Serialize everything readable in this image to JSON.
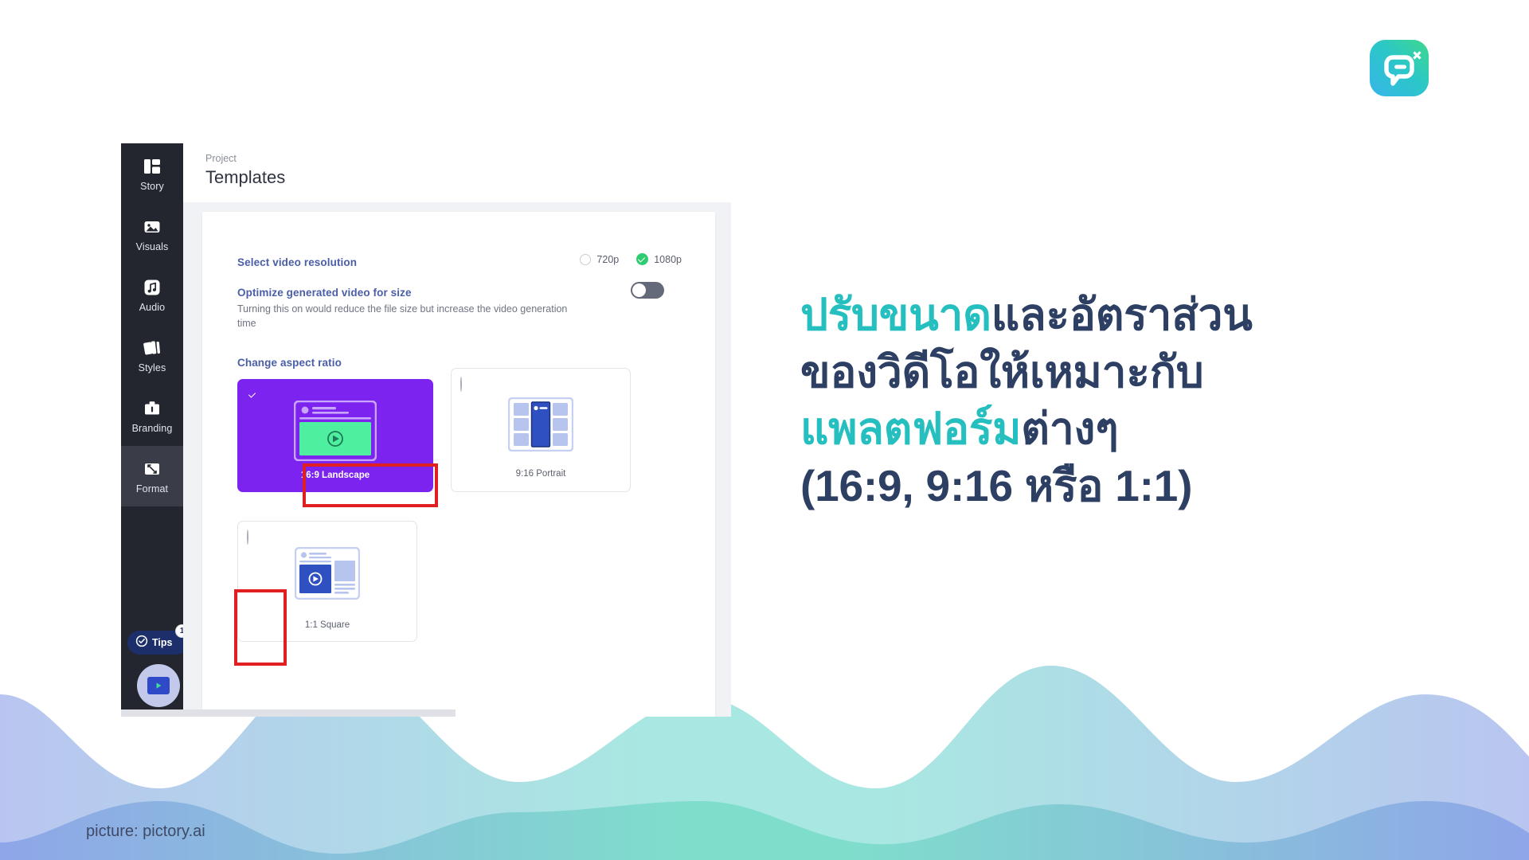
{
  "brand": {
    "logo_name": "pictory-logo",
    "accent_teal": "#25bfbf",
    "navy": "#2d3f63",
    "purple": "#7c23f0",
    "green": "#2ecc71",
    "highlight_red": "#e02020"
  },
  "app": {
    "breadcrumb": "Project",
    "page_title": "Templates",
    "sidebar": {
      "items": [
        {
          "label": "Story",
          "icon": "story-icon",
          "active": false
        },
        {
          "label": "Visuals",
          "icon": "image-icon",
          "active": false
        },
        {
          "label": "Audio",
          "icon": "music-icon",
          "active": false
        },
        {
          "label": "Styles",
          "icon": "cards-icon",
          "active": false
        },
        {
          "label": "Branding",
          "icon": "briefcase-icon",
          "active": false
        },
        {
          "label": "Format",
          "icon": "resize-icon",
          "active": true
        }
      ],
      "tips_label": "Tips",
      "tips_badge": "1"
    },
    "settings": {
      "resolution_label": "Select video resolution",
      "resolution_options": [
        {
          "label": "720p",
          "selected": false
        },
        {
          "label": "1080p",
          "selected": true
        }
      ],
      "optimize_label": "Optimize generated video for size",
      "optimize_desc": "Turning this on would reduce the file size but increase the video generation time",
      "optimize_on": false,
      "aspect_label": "Change aspect ratio"
    },
    "aspect_tiles": [
      {
        "caption": "16:9 Landscape",
        "selected": true,
        "art": "landscape-preview"
      },
      {
        "caption": "9:16 Portrait",
        "selected": false,
        "art": "portrait-preview"
      },
      {
        "caption": "1:1 Square",
        "selected": false,
        "art": "square-preview"
      }
    ]
  },
  "headline": {
    "line1_highlight": "ปรับขนาด",
    "line1_rest": "และอัตราส่วน",
    "line2": "ของวิดีโอให้เหมาะกับ",
    "line3_highlight": "แพลตฟอร์ม",
    "line3_rest": "ต่างๆ",
    "line4": "(16:9, 9:16 หรือ 1:1)"
  },
  "credit": "picture: pictory.ai"
}
